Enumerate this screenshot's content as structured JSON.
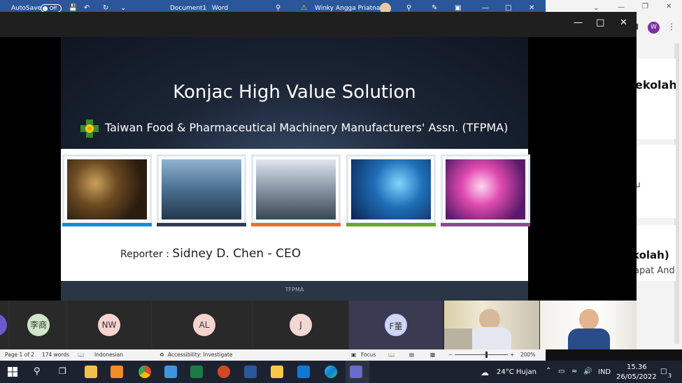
{
  "word": {
    "autosave_label": "AutoSave",
    "autosave_state": "Off",
    "doc_title": "Document1",
    "app_name": "Word",
    "user_name": "Winky Angga Priatna"
  },
  "chrome": {
    "profile_initial": "W"
  },
  "presentation": {
    "slide_title": "Konjac High Value Solution",
    "organization": "Taiwan Food & Pharmaceutical Machinery Manufacturers' Assn. (TFPMA)",
    "reporter_label": "Reporter :",
    "reporter_name": "Sidney D. Chen - CEO",
    "footer": "TFPMA",
    "photo_bar_colors": [
      "#0a8fd6",
      "#2f3d52",
      "#e8702a",
      "#6aa52b",
      "#8a4a8a"
    ]
  },
  "right_panel": {
    "card1_text": "ekolah",
    "card2_text": "u",
    "card3_title": "kolah)",
    "card3_sub": "apat And"
  },
  "participants": [
    {
      "initials": "李商",
      "color": "#cfe6c8"
    },
    {
      "initials": "NW",
      "color": "#f6d3cf"
    },
    {
      "initials": "AL",
      "color": "#f6d3cf"
    },
    {
      "initials": "J",
      "color": "#f3d7d3"
    },
    {
      "initials": "F董",
      "color": "#cfd7f3"
    }
  ],
  "status": {
    "page": "Page 1 of 2",
    "words": "174 words",
    "language": "Indonesian",
    "accessibility": "Accessibility: Investigate",
    "focus": "Focus",
    "zoom": "200%"
  },
  "taskbar": {
    "weather": "24°C Hujan",
    "lang": "IND",
    "time": "15.36",
    "date": "26/05/2022",
    "notifications": "3"
  }
}
